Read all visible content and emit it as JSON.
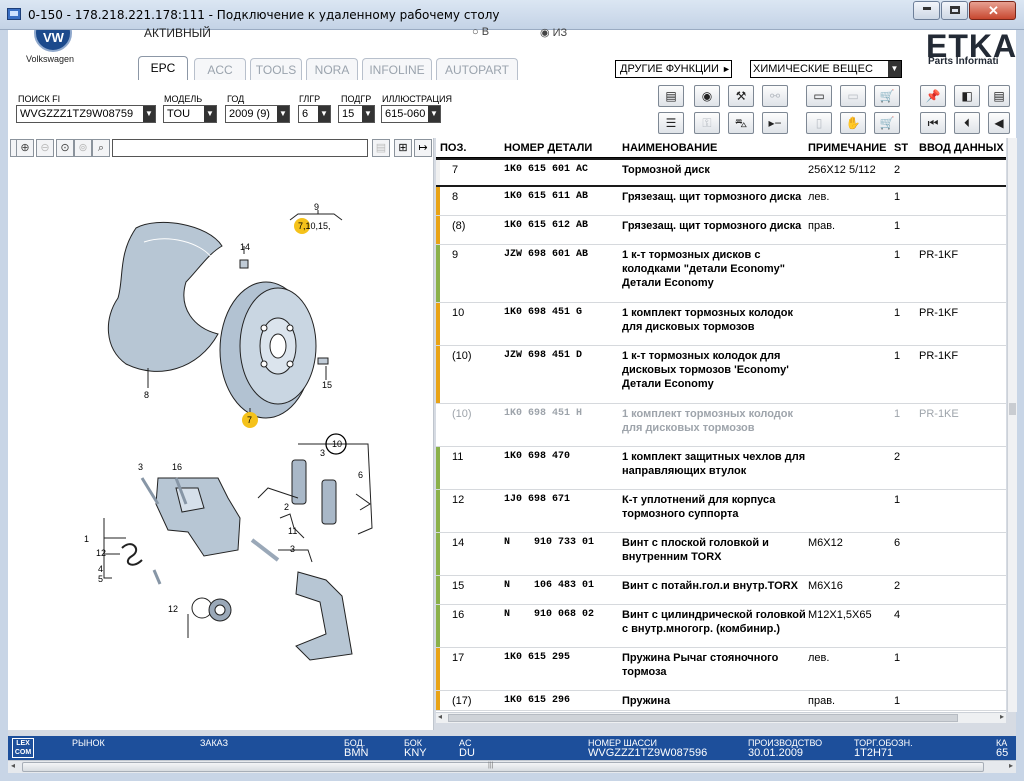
{
  "window": {
    "title": "0-150 - 178.218.221.178:111 - Подключение к удаленному рабочему столу"
  },
  "header": {
    "brand": "Volkswagen",
    "status": "АКТИВНЫЙ",
    "radio_b": "○ В",
    "radio_iz": "◉ ИЗ",
    "logo": "ETKA",
    "logo_sub": "Parts Informati",
    "tabs": [
      "EPC",
      "ACC",
      "TOOLS",
      "NORA",
      "INFOLINE",
      "AUTOPART"
    ],
    "other_functions": "ДРУГИЕ ФУНКЦИИ",
    "chem_select": "ХИМИЧЕСКИЕ ВЕЩЕС"
  },
  "filters": {
    "search_fi": {
      "label": "ПОИСК FI",
      "value": "WVGZZZ1TZ9W08759"
    },
    "model": {
      "label": "МОДЕЛЬ",
      "value": "TOU"
    },
    "year": {
      "label": "ГОД",
      "value": "2009 (9)"
    },
    "glgr": {
      "label": "ГЛГР",
      "value": "6"
    },
    "podgr": {
      "label": "ПОДГР",
      "value": "15"
    },
    "illus": {
      "label": "ИЛЛЮСТРАЦИЯ",
      "value": "615-060"
    }
  },
  "illustration": {
    "callouts": [
      "9",
      "7,10,15,",
      "14",
      "8",
      "7",
      "15",
      "3",
      "16",
      "10",
      "3",
      "6",
      "2",
      "11",
      "3",
      "1",
      "12",
      "4",
      "5",
      "12"
    ]
  },
  "table": {
    "headers": [
      "ПОЗ.",
      "НОМЕР ДЕТАЛИ",
      "НАИМЕНОВАНИЕ",
      "ПРИМЕЧАНИЕ",
      "ST",
      "ВВОД ДАННЫХ П"
    ],
    "rows": [
      {
        "pos": "7",
        "num": "1K0 615 601 AC",
        "name": "Тормозной диск",
        "note": "256X12  5/112",
        "st": "2",
        "inp": "",
        "mark": "#f0f0f0"
      },
      {
        "pos": "8",
        "num": "1K0 615 611 AB",
        "name": "Грязезащ. щит тормозного диска",
        "note": "лев.",
        "st": "1",
        "inp": "",
        "mark": "#e8a317"
      },
      {
        "pos": "(8)",
        "num": "1K0 615 612 AB",
        "name": "Грязезащ. щит тормозного диска",
        "note": "прав.",
        "st": "1",
        "inp": "",
        "mark": "#e8a317"
      },
      {
        "pos": "9",
        "num": "JZW 698 601 AB",
        "name": "1 к-т тормозных дисков с колодками   \"детали Economy\" Детали Economy",
        "note": "",
        "st": "1",
        "inp": "PR-1KF",
        "mark": "#8ab04a"
      },
      {
        "pos": "10",
        "num": "1K0 698 451 G",
        "name": "1 комплект тормозных колодок для дисковых тормозов",
        "note": "",
        "st": "1",
        "inp": "PR-1KF",
        "mark": "#e8a317"
      },
      {
        "pos": "(10)",
        "num": "JZW 698 451 D",
        "name": "1 к-т тормозных колодок для дисковых тормозов 'Economy' Детали Economy",
        "note": "",
        "st": "1",
        "inp": "PR-1KF",
        "mark": "#e8a317"
      },
      {
        "pos": "(10)",
        "num": "1K0 698 451 H",
        "name": "1 комплект тормозных колодок для дисковых тормозов",
        "note": "",
        "st": "1",
        "inp": "PR-1KE",
        "mark": ""
      },
      {
        "pos": "11",
        "num": "1K0 698 470",
        "name": "1 комплект защитных чехлов для направляющих втулок",
        "note": "",
        "st": "2",
        "inp": "",
        "mark": "#8ab04a"
      },
      {
        "pos": "12",
        "num": "1J0 698 671",
        "name": "К-т уплотнений для корпуса тормозного суппорта",
        "note": "",
        "st": "1",
        "inp": "",
        "mark": "#8ab04a"
      },
      {
        "pos": "14",
        "num": "N    910 733 01",
        "name": "Винт с плоской головкой и внутренним TORX",
        "note": "M6X12",
        "st": "6",
        "inp": "",
        "mark": "#8ab04a"
      },
      {
        "pos": "15",
        "num": "N    106 483 01",
        "name": "Винт с потайн.гол.и внутр.TORX",
        "note": "M6X16",
        "st": "2",
        "inp": "",
        "mark": "#8ab04a"
      },
      {
        "pos": "16",
        "num": "N    910 068 02",
        "name": "Винт с цилиндрической головкой с внутр.многогр. (комбинир.)",
        "note": "M12X1,5X65",
        "st": "4",
        "inp": "",
        "mark": "#8ab04a"
      },
      {
        "pos": "17",
        "num": "1K0 615 295",
        "name": "Пружина Рычаг стояночного тормоза",
        "note": "лев.",
        "st": "1",
        "inp": "",
        "mark": "#e8a317"
      },
      {
        "pos": "(17)",
        "num": "1K0 615 296",
        "name": "Пружина",
        "note": "прав.",
        "st": "1",
        "inp": "",
        "mark": "#e8a317"
      }
    ]
  },
  "statusbar": {
    "logo": "LEX COM",
    "market": "РЫНОК",
    "order": "ЗАКАЗ",
    "bod_label": "БОД.",
    "bod_value": "BMN",
    "bok_label": "БОК",
    "bok_value": "KNY",
    "ac_label": "AC",
    "ac_value": "DU",
    "chassis_label": "НОМЕР ШАССИ",
    "chassis_value": "WVGZZZ1TZ9W087596",
    "prod_label": "ПРОИЗВОДСТВО",
    "prod_value": "30.01.2009",
    "torg_label": "ТОРГ.ОБОЗН.",
    "torg_value": "1T2H71",
    "ka_label": "КА",
    "ka_value": "65"
  }
}
